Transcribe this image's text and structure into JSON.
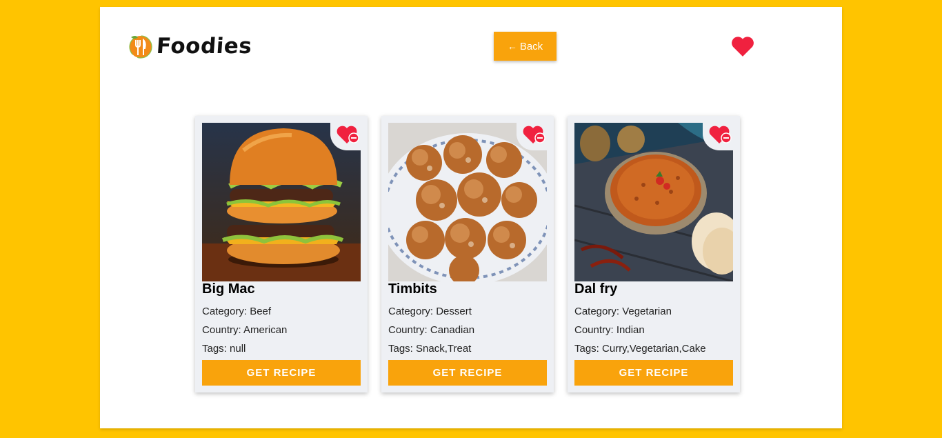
{
  "header": {
    "logo_text": "Foodies",
    "back_label": "Back",
    "favorites_icon": "heart-icon"
  },
  "colors": {
    "background": "#ffc400",
    "accent": "#f9a30c",
    "heart": "#f0213f",
    "card": "#eef0f4"
  },
  "cards": [
    {
      "title": "Big Mac",
      "category": "Category: Beef",
      "country": "Country: American",
      "tags": "Tags: null",
      "button": "GET RECIPE"
    },
    {
      "title": "Timbits",
      "category": "Category: Dessert",
      "country": "Country: Canadian",
      "tags": "Tags: Snack,Treat",
      "button": "GET RECIPE"
    },
    {
      "title": "Dal fry",
      "category": "Category: Vegetarian",
      "country": "Country: Indian",
      "tags": "Tags: Curry,Vegetarian,Cake",
      "button": "GET RECIPE"
    }
  ]
}
